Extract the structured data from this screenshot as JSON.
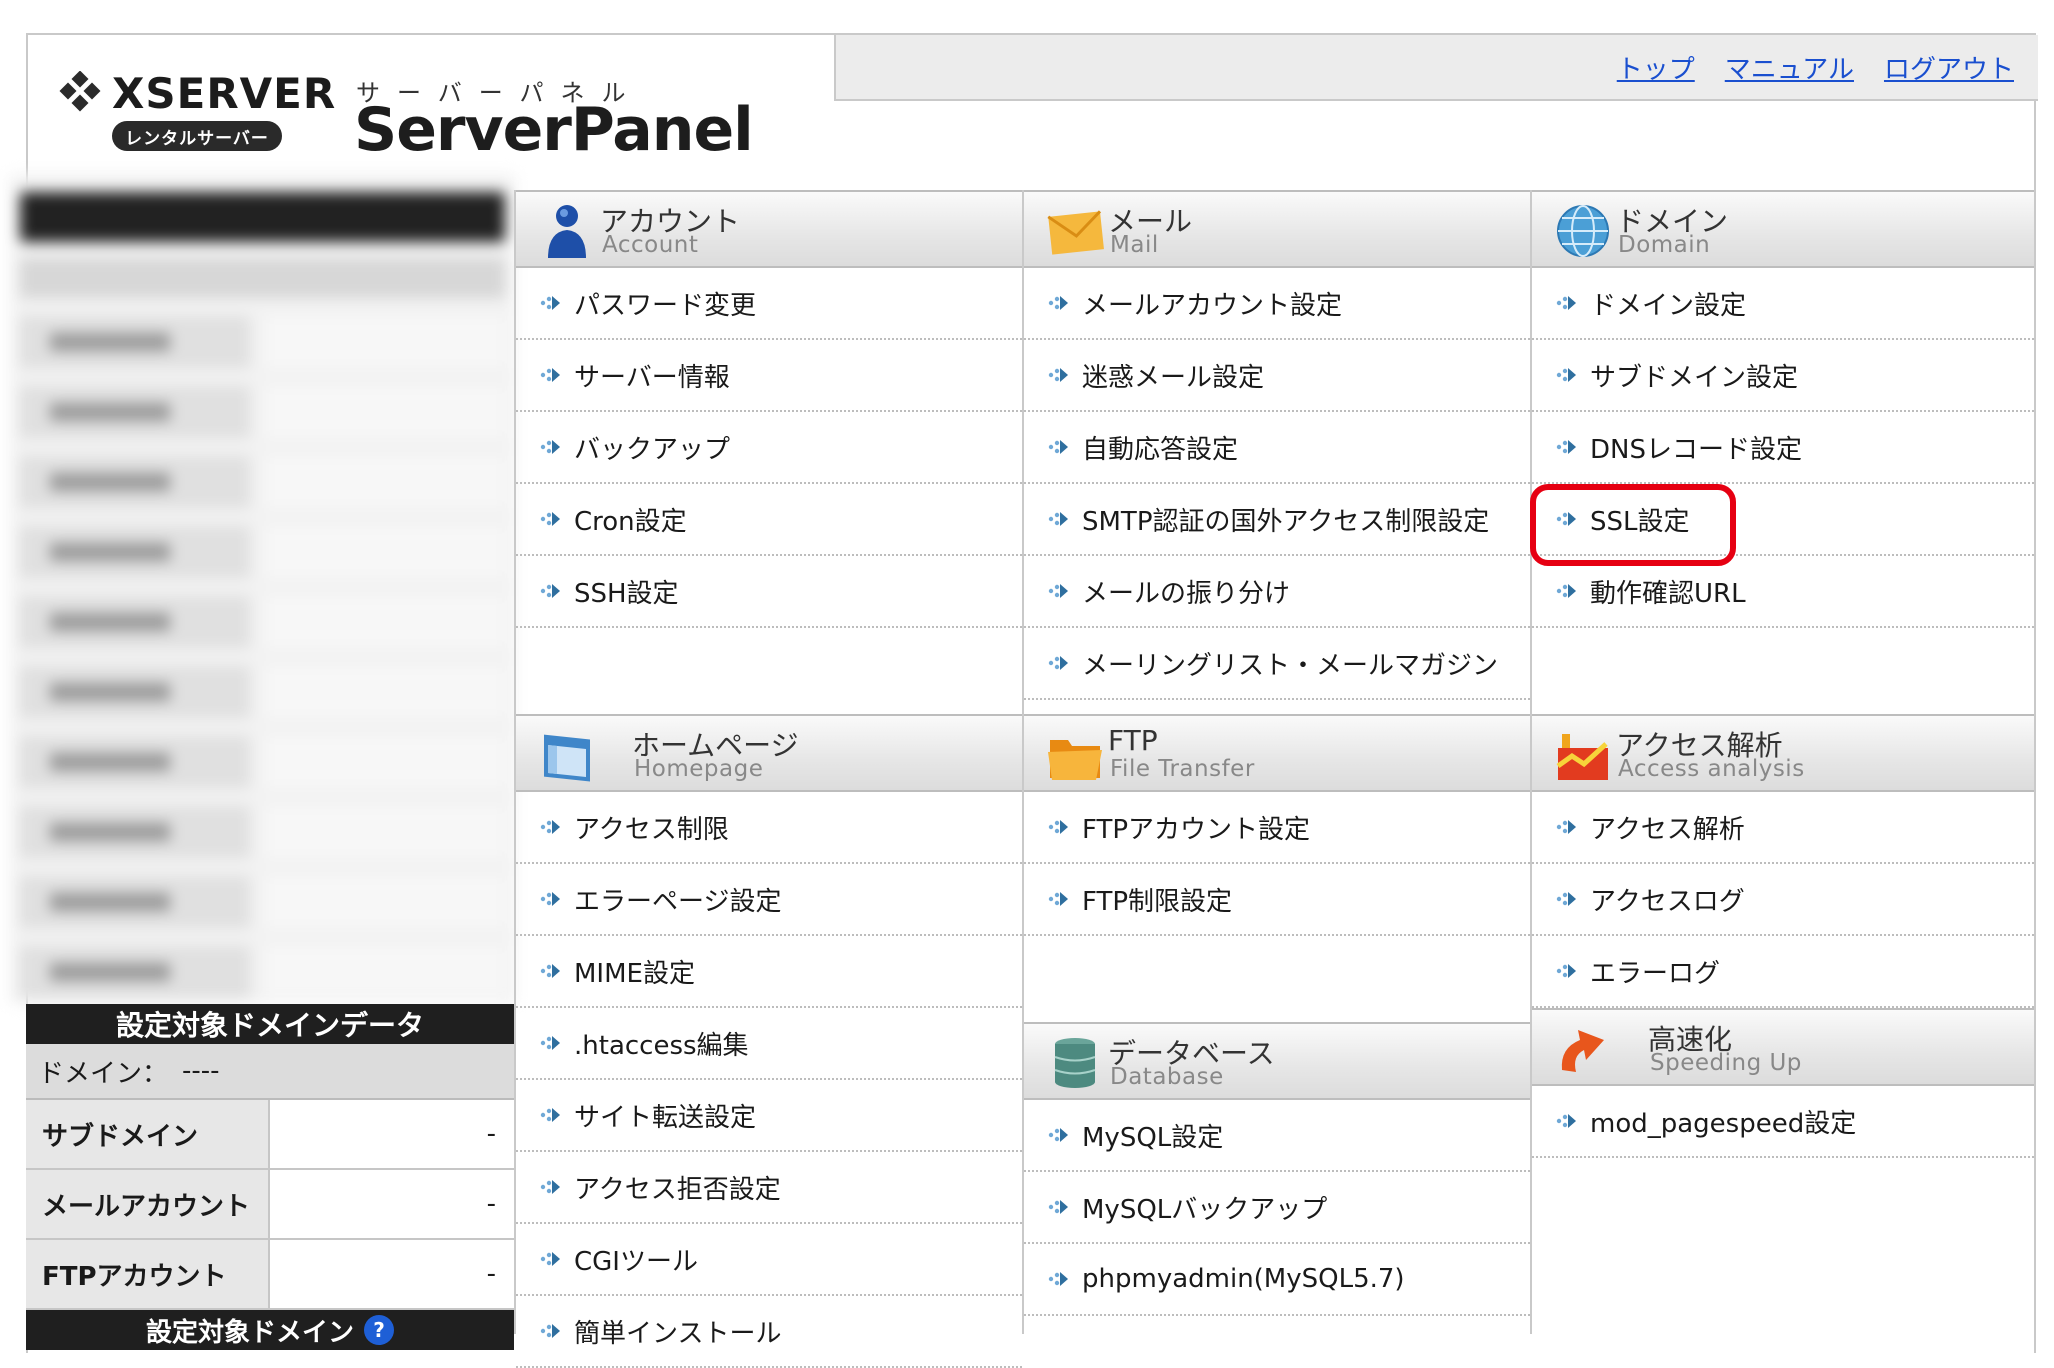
{
  "header": {
    "brand": "XSERVER",
    "badge": "レンタルサーバー",
    "panel_sub": "サーバーパネル",
    "panel_title": "ServerPanel",
    "links": [
      "トップ",
      "マニュアル",
      "ログアウト"
    ]
  },
  "sidebar": {
    "data_title": "設定対象ドメインデータ",
    "domain_label": "ドメイン：",
    "domain_value": "----",
    "rows": [
      {
        "label": "サブドメイン",
        "value": "-"
      },
      {
        "label": "メールアカウント",
        "value": "-"
      },
      {
        "label": "FTPアカウント",
        "value": "-"
      }
    ],
    "footer_title": "設定対象ドメイン",
    "help_icon": "?"
  },
  "sections": {
    "account": {
      "jp": "アカウント",
      "en": "Account",
      "icon": "user-icon",
      "items": [
        "パスワード変更",
        "サーバー情報",
        "バックアップ",
        "Cron設定",
        "SSH設定"
      ]
    },
    "mail": {
      "jp": "メール",
      "en": "Mail",
      "icon": "envelope-icon",
      "items": [
        "メールアカウント設定",
        "迷惑メール設定",
        "自動応答設定",
        "SMTP認証の国外アクセス制限設定",
        "メールの振り分け",
        "メーリングリスト・メールマガジン"
      ]
    },
    "domain": {
      "jp": "ドメイン",
      "en": "Domain",
      "icon": "globe-icon",
      "items": [
        "ドメイン設定",
        "サブドメイン設定",
        "DNSレコード設定",
        "SSL設定",
        "動作確認URL"
      ]
    },
    "homepage": {
      "jp": "ホームページ",
      "en": "Homepage",
      "icon": "window-icon",
      "items": [
        "アクセス制限",
        "エラーページ設定",
        "MIME設定",
        ".htaccess編集",
        "サイト転送設定",
        "アクセス拒否設定",
        "CGIツール",
        "簡単インストール"
      ]
    },
    "ftp": {
      "jp": "FTP",
      "en": "File Transfer",
      "icon": "folder-icon",
      "items": [
        "FTPアカウント設定",
        "FTP制限設定"
      ]
    },
    "access": {
      "jp": "アクセス解析",
      "en": "Access analysis",
      "icon": "chart-icon",
      "items": [
        "アクセス解析",
        "アクセスログ",
        "エラーログ"
      ]
    },
    "database": {
      "jp": "データベース",
      "en": "Database",
      "icon": "database-icon",
      "items": [
        "MySQL設定",
        "MySQLバックアップ",
        "phpmyadmin(MySQL5.7)"
      ]
    },
    "speed": {
      "jp": "高速化",
      "en": "Speeding Up",
      "icon": "speed-arrow-icon",
      "items": [
        "mod_pagespeed設定"
      ]
    }
  },
  "highlighted_item": "SSL設定",
  "colors": {
    "link": "#1a4fcf",
    "highlight": "#e60012",
    "arrow": "#2f7fb5"
  }
}
